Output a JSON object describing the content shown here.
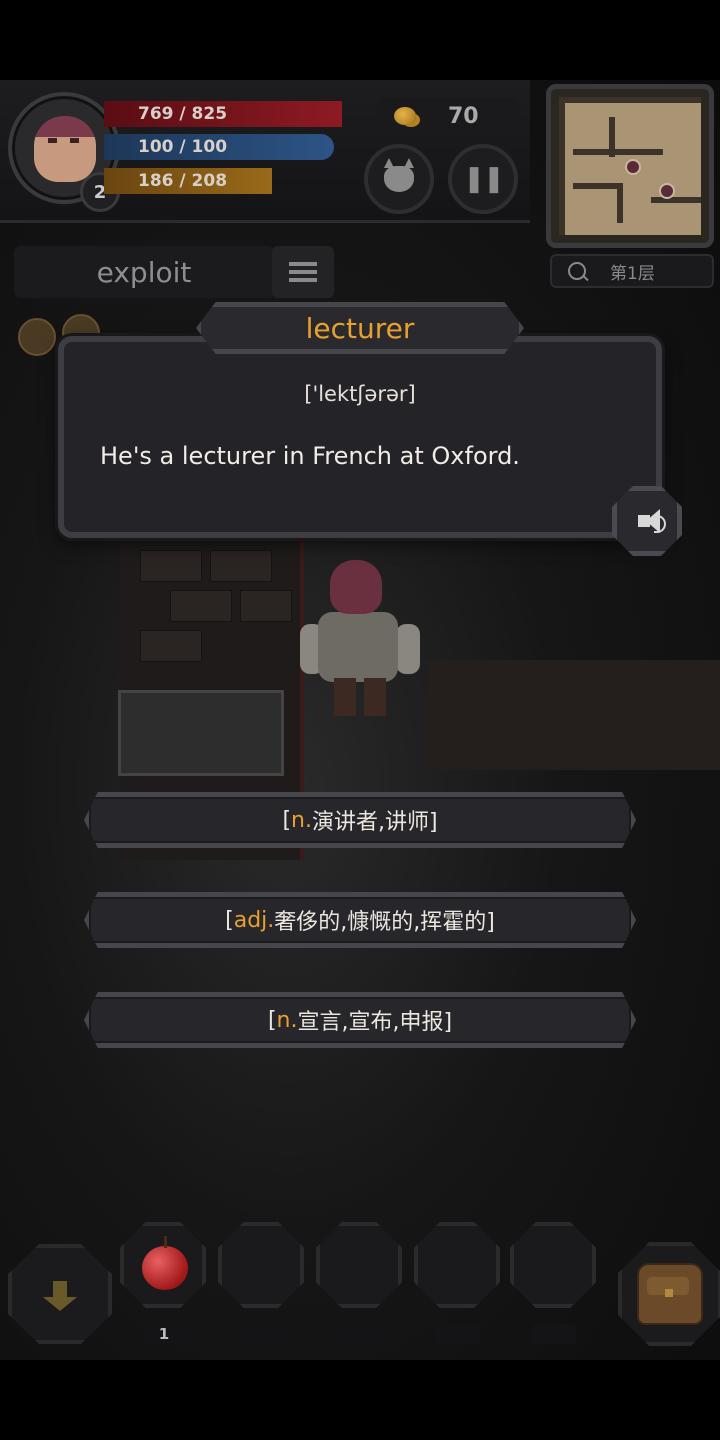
{
  "hud": {
    "player_level": "2",
    "hp": "769 / 825",
    "mp": "100 / 100",
    "xp": "186 / 208",
    "hp_fraction": 0.93,
    "mp_fraction": 1.0,
    "xp_fraction": 0.89,
    "coins": "70",
    "floor_label": "第1层",
    "current_word_tab": "exploit"
  },
  "card": {
    "word": "lecturer",
    "phonetic": "['lektʃərər]",
    "example": "He's a lecturer in French at Oxford."
  },
  "answers": [
    {
      "pos": "n.",
      "meaning": " 演讲者,讲师]",
      "open": "["
    },
    {
      "pos": "adj.",
      "meaning": " 奢侈的,慷慨的,挥霍的]",
      "open": "["
    },
    {
      "pos": "n.",
      "meaning": " 宣言,宣布,申报]",
      "open": "["
    }
  ],
  "inventory": {
    "slots": [
      {
        "item": "apple-icon",
        "count": "1"
      },
      {
        "item": "",
        "count": ""
      },
      {
        "item": "",
        "count": ""
      },
      {
        "item": "",
        "count": ""
      },
      {
        "item": "",
        "count": ""
      }
    ]
  },
  "colors": {
    "accent": "#e8a030",
    "hp_bar": "#8e1a22",
    "mp_bar": "#2c5486",
    "xp_bar": "#9a6a1a"
  },
  "icons": {
    "monster": "demon-face-icon",
    "pause": "pause-icon",
    "menu": "list-menu-icon",
    "speaker": "speaker-icon",
    "down": "arrow-down-icon",
    "bag": "backpack-icon",
    "search": "search-icon",
    "coin": "coin-icon"
  }
}
